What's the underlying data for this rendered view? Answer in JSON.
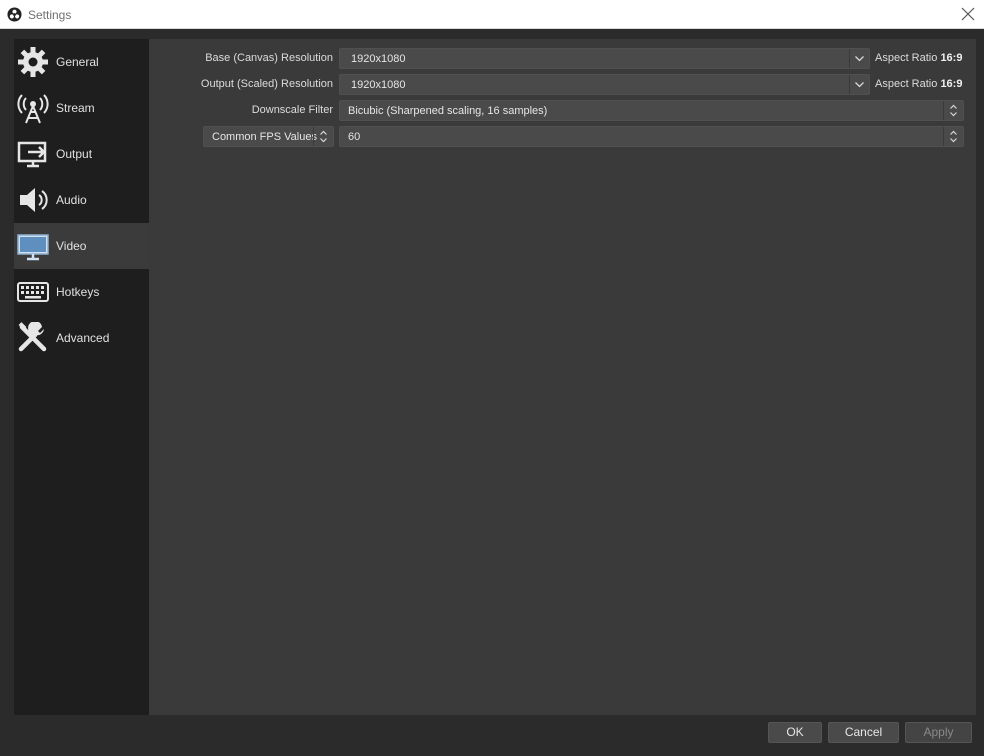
{
  "window": {
    "title": "Settings"
  },
  "sidebar": {
    "items": [
      {
        "label": "General",
        "icon": "gear-icon",
        "active": false
      },
      {
        "label": "Stream",
        "icon": "antenna-icon",
        "active": false
      },
      {
        "label": "Output",
        "icon": "output-monitor-icon",
        "active": false
      },
      {
        "label": "Audio",
        "icon": "speaker-icon",
        "active": false
      },
      {
        "label": "Video",
        "icon": "monitor-icon",
        "active": true
      },
      {
        "label": "Hotkeys",
        "icon": "keyboard-icon",
        "active": false
      },
      {
        "label": "Advanced",
        "icon": "tools-icon",
        "active": false
      }
    ]
  },
  "video": {
    "base_resolution": {
      "label": "Base (Canvas) Resolution",
      "value": "1920x1080",
      "aspect_label": "Aspect Ratio",
      "aspect_value": "16:9"
    },
    "output_resolution": {
      "label": "Output (Scaled) Resolution",
      "value": "1920x1080",
      "aspect_label": "Aspect Ratio",
      "aspect_value": "16:9"
    },
    "downscale_filter": {
      "label": "Downscale Filter",
      "value": "Bicubic (Sharpened scaling, 16 samples)"
    },
    "fps": {
      "type_value": "Common FPS Values",
      "value": "60"
    }
  },
  "footer": {
    "ok_label": "OK",
    "cancel_label": "Cancel",
    "apply_label": "Apply"
  }
}
